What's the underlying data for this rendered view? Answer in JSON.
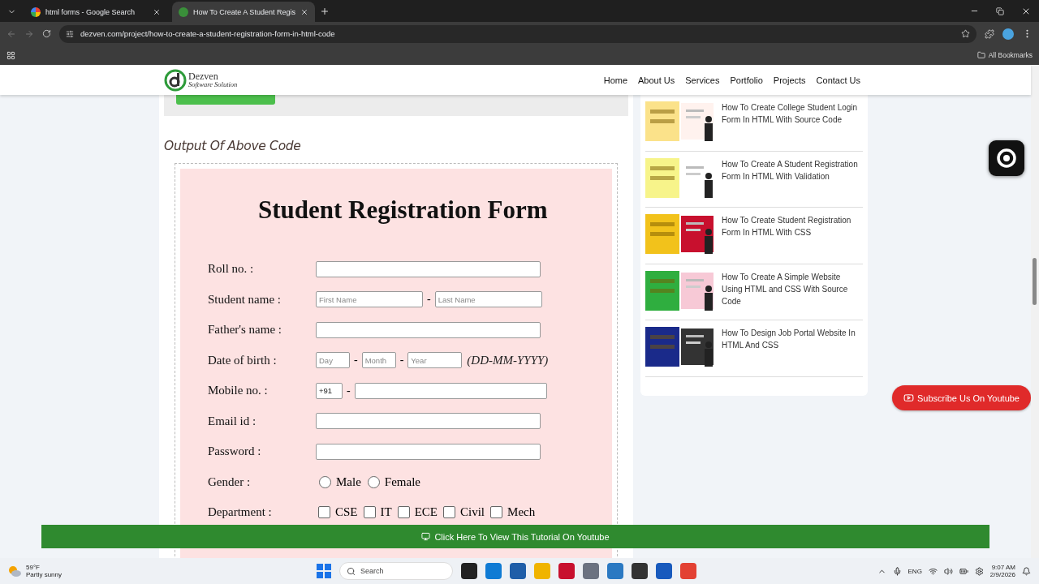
{
  "browser": {
    "tabs": [
      {
        "title": "html forms - Google Search",
        "selected": false
      },
      {
        "title": "How To Create A Student Regis",
        "selected": true
      }
    ],
    "address": "dezven.com/project/how-to-create-a-student-registration-form-in-html-code",
    "bookmarks_label": "All Bookmarks"
  },
  "site": {
    "logo_name": "Dezven",
    "logo_tagline": "Software Solution",
    "nav": [
      "Home",
      "About Us",
      "Services",
      "Portfolio",
      "Projects",
      "Contact Us"
    ]
  },
  "output_heading": "Output Of Above Code",
  "form": {
    "title": "Student Registration Form",
    "fields": [
      {
        "label": "Roll no. :",
        "kind": "text"
      },
      {
        "label": "Student name :",
        "kind": "pair",
        "placeholders": [
          "First Name",
          "Last Name"
        ],
        "separator": "-"
      },
      {
        "label": "Father's name :",
        "kind": "text"
      },
      {
        "label": "Date of birth :",
        "kind": "date",
        "placeholders": [
          "Day",
          "Month",
          "Year"
        ],
        "separator": "-",
        "hint": "(DD-MM-YYYY)"
      },
      {
        "label": "Mobile no. :",
        "kind": "phone",
        "value": "+91",
        "separator": "-"
      },
      {
        "label": "Email id :",
        "kind": "text"
      },
      {
        "label": "Password :",
        "kind": "text"
      },
      {
        "label": "Gender :",
        "kind": "radio",
        "options": [
          {
            "label": "Male",
            "selected": false
          },
          {
            "label": "Female",
            "selected": false
          }
        ]
      },
      {
        "label": "Department :",
        "kind": "checkbox",
        "options": [
          {
            "label": "CSE",
            "checked": false
          },
          {
            "label": "IT",
            "checked": false
          },
          {
            "label": "ECE",
            "checked": false
          },
          {
            "label": "Civil",
            "checked": false
          },
          {
            "label": "Mech",
            "checked": false
          }
        ]
      }
    ]
  },
  "sidebar": {
    "posts": [
      {
        "title": "How To Create College Student Login Form In HTML With Source Code"
      },
      {
        "title": "How To Create A Student Registration Form In HTML With Validation"
      },
      {
        "title": "How To Create Student Registration Form In HTML With CSS"
      },
      {
        "title": "How To Create A Simple Website Using HTML and CSS With Source Code"
      },
      {
        "title": "How To Design Job Portal Website In HTML And CSS"
      }
    ]
  },
  "subscribe_button": "Subscribe Us On Youtube",
  "tutorial_bar": "Click Here To View This Tutorial On Youtube",
  "taskbar": {
    "weather_temp": "59°F",
    "weather_text": "Partly sunny",
    "search_placeholder": "Search",
    "language": "ENG",
    "time": "9:07 AM",
    "date": "2/9/2026"
  }
}
